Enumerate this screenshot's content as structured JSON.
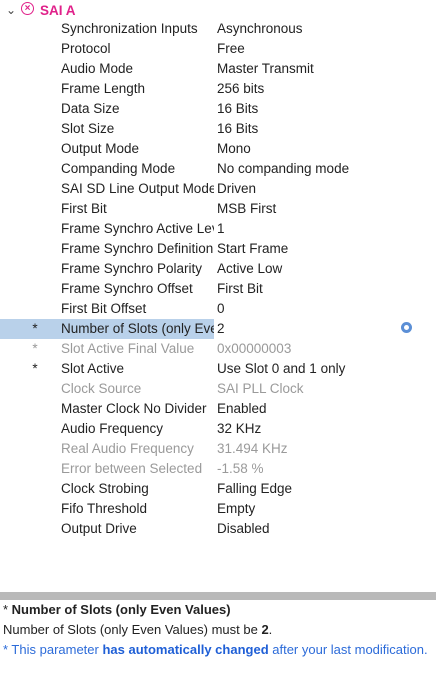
{
  "header": {
    "title": "SAI A",
    "chevron_icon": "chevron-down-icon",
    "status_icon": "error-circle-icon"
  },
  "rows": [
    {
      "label": "Synchronization Inputs",
      "value": "Asynchronous",
      "star": "",
      "state": "normal"
    },
    {
      "label": "Protocol",
      "value": "Free",
      "star": "",
      "state": "normal"
    },
    {
      "label": "Audio Mode",
      "value": "Master Transmit",
      "star": "",
      "state": "normal"
    },
    {
      "label": "Frame Length",
      "value": "256 bits",
      "star": "",
      "state": "normal"
    },
    {
      "label": "Data Size",
      "value": "16 Bits",
      "star": "",
      "state": "normal"
    },
    {
      "label": "Slot Size",
      "value": "16 Bits",
      "star": "",
      "state": "normal"
    },
    {
      "label": "Output Mode",
      "value": "Mono",
      "star": "",
      "state": "normal"
    },
    {
      "label": "Companding Mode",
      "value": "No companding mode",
      "star": "",
      "state": "normal"
    },
    {
      "label": "SAI SD Line Output Mode",
      "value": "Driven",
      "star": "",
      "state": "normal"
    },
    {
      "label": "First Bit",
      "value": "MSB First",
      "star": "",
      "state": "normal"
    },
    {
      "label": "Frame Synchro Active Lev...",
      "value": "1",
      "star": "",
      "state": "normal"
    },
    {
      "label": "Frame Synchro Definition",
      "value": "Start Frame",
      "star": "",
      "state": "normal"
    },
    {
      "label": "Frame Synchro Polarity",
      "value": "Active Low",
      "star": "",
      "state": "normal"
    },
    {
      "label": "Frame Synchro Offset",
      "value": "First Bit",
      "star": "",
      "state": "normal"
    },
    {
      "label": "First Bit Offset",
      "value": "0",
      "star": "",
      "state": "normal"
    },
    {
      "label": "Number of Slots (only Even",
      "value": "2",
      "star": "*",
      "state": "selected"
    },
    {
      "label": "Slot Active Final Value",
      "value": "0x00000003",
      "star": "*",
      "state": "disabled"
    },
    {
      "label": "Slot Active",
      "value": "Use Slot 0 and 1 only",
      "star": "*",
      "state": "normal"
    },
    {
      "label": "Clock Source",
      "value": "SAI PLL Clock",
      "star": "",
      "state": "disabled"
    },
    {
      "label": "Master Clock No Divider",
      "value": "Enabled",
      "star": "",
      "state": "normal"
    },
    {
      "label": "Audio Frequency",
      "value": "32 KHz",
      "star": "",
      "state": "normal"
    },
    {
      "label": "Real Audio Frequency",
      "value": "31.494 KHz",
      "star": "",
      "state": "disabled"
    },
    {
      "label": "Error between Selected",
      "value": "-1.58 %",
      "star": "",
      "state": "disabled"
    },
    {
      "label": "Clock Strobing",
      "value": "Falling Edge",
      "star": "",
      "state": "normal"
    },
    {
      "label": "Fifo Threshold",
      "value": "Empty",
      "star": "",
      "state": "normal"
    },
    {
      "label": "Output Drive",
      "value": "Disabled",
      "star": "",
      "state": "normal"
    }
  ],
  "selected_row_icon": "gear-icon",
  "description": {
    "title_star": "* ",
    "title": "Number of Slots (only Even Values)",
    "line2_prefix": "Number of Slots (only Even Values) must be ",
    "line2_value": "2",
    "line2_suffix": ".",
    "line3_prefix": "* This parameter ",
    "line3_emph": "has automatically changed",
    "line3_suffix": " after your last modification."
  },
  "colors": {
    "error_accent": "#e0218a",
    "selection": "#b9d1ea",
    "disabled_text": "#9a9a9a",
    "info_blue": "#2c6bd9"
  }
}
